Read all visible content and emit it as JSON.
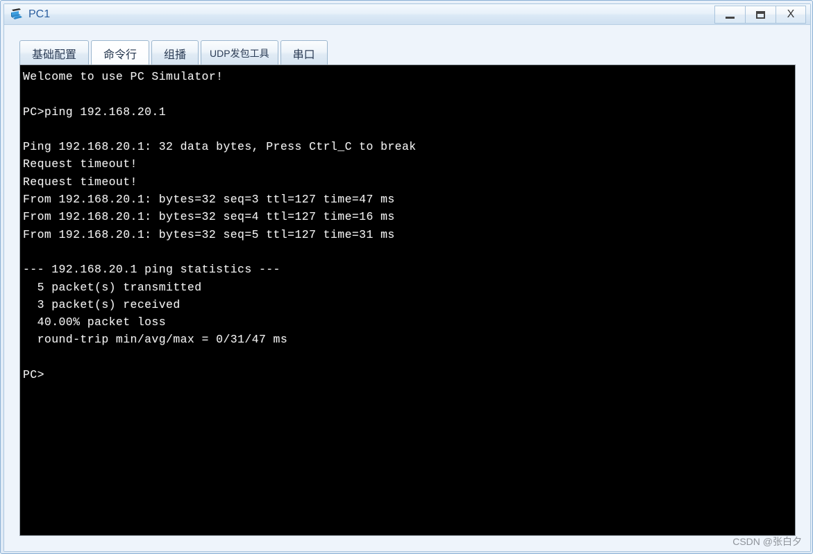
{
  "window": {
    "title": "PC1",
    "icon": "pc-device-icon",
    "controls": {
      "minimize_label": "_",
      "maximize_label": "□",
      "close_label": "X",
      "minimize_icon": "minimize-icon",
      "maximize_icon": "maximize-icon",
      "close_icon": "close-icon"
    }
  },
  "tabs": [
    {
      "label": "基础配置",
      "selected": false,
      "small": false
    },
    {
      "label": "命令行",
      "selected": true,
      "small": false
    },
    {
      "label": "组播",
      "selected": false,
      "small": false
    },
    {
      "label": "UDP发包工具",
      "selected": false,
      "small": true
    },
    {
      "label": "串口",
      "selected": false,
      "small": false
    }
  ],
  "terminal": {
    "lines": [
      "Welcome to use PC Simulator!",
      "",
      "PC>ping 192.168.20.1",
      "",
      "Ping 192.168.20.1: 32 data bytes, Press Ctrl_C to break",
      "Request timeout!",
      "Request timeout!",
      "From 192.168.20.1: bytes=32 seq=3 ttl=127 time=47 ms",
      "From 192.168.20.1: bytes=32 seq=4 ttl=127 time=16 ms",
      "From 192.168.20.1: bytes=32 seq=5 ttl=127 time=31 ms",
      "",
      "--- 192.168.20.1 ping statistics ---",
      "  5 packet(s) transmitted",
      "  3 packet(s) received",
      "  40.00% packet loss",
      "  round-trip min/avg/max = 0/31/47 ms",
      "",
      "PC>"
    ],
    "prompt": "PC>",
    "background_color": "#000000",
    "text_color": "#f2f2f2"
  },
  "watermark": {
    "text": "CSDN @张白夕"
  },
  "colors": {
    "window_frame": "#8ab0d4",
    "titlebar_text": "#2a5d9e",
    "panel_background": "#eef4fb",
    "terminal_background": "#000000"
  }
}
